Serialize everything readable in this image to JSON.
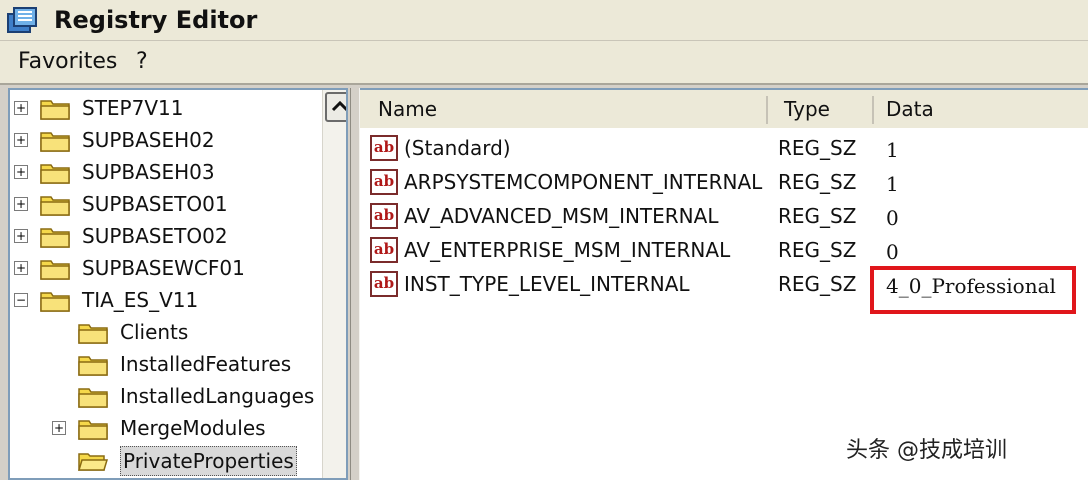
{
  "window": {
    "title": "Registry Editor",
    "app_icon": "regedit-icon"
  },
  "menu": {
    "items": [
      "Favorites",
      "?"
    ]
  },
  "tree": {
    "items": [
      {
        "label": "STEP7V11",
        "expander": "+",
        "level": 0
      },
      {
        "label": "SUPBASEH02",
        "expander": "+",
        "level": 0
      },
      {
        "label": "SUPBASEH03",
        "expander": "+",
        "level": 0
      },
      {
        "label": "SUPBASETO01",
        "expander": "+",
        "level": 0
      },
      {
        "label": "SUPBASETO02",
        "expander": "+",
        "level": 0
      },
      {
        "label": "SUPBASEWCF01",
        "expander": "+",
        "level": 0
      },
      {
        "label": "TIA_ES_V11",
        "expander": "−",
        "level": 0
      },
      {
        "label": "Clients",
        "expander": "",
        "level": 1
      },
      {
        "label": "InstalledFeatures",
        "expander": "",
        "level": 1
      },
      {
        "label": "InstalledLanguages",
        "expander": "",
        "level": 1
      },
      {
        "label": "MergeModules",
        "expander": "+",
        "level": 1
      },
      {
        "label": "PrivateProperties",
        "expander": "",
        "level": 1,
        "selected": true
      }
    ]
  },
  "list": {
    "columns": [
      "Name",
      "Type",
      "Data"
    ],
    "rows": [
      {
        "name": "(Standard)",
        "type": "REG_SZ",
        "data": "1"
      },
      {
        "name": "ARPSYSTEMCOMPONENT_INTERNAL",
        "type": "REG_SZ",
        "data": "1"
      },
      {
        "name": "AV_ADVANCED_MSM_INTERNAL",
        "type": "REG_SZ",
        "data": "0"
      },
      {
        "name": "AV_ENTERPRISE_MSM_INTERNAL",
        "type": "REG_SZ",
        "data": "0"
      },
      {
        "name": "INST_TYPE_LEVEL_INTERNAL",
        "type": "REG_SZ",
        "data": "4_0_Professional"
      }
    ],
    "value_icon_text": "ab"
  },
  "watermark": "头条 @技成培训",
  "colors": {
    "highlight": "#e0161b",
    "folder": "#f5d84a"
  }
}
